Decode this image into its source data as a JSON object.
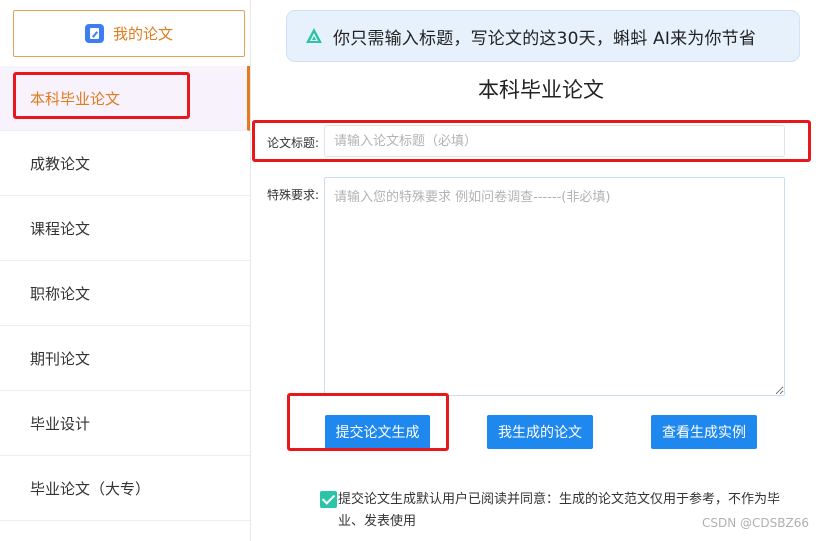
{
  "sidebar": {
    "my_paper_label": "我的论文",
    "items": [
      {
        "label": "本科毕业论文",
        "active": true
      },
      {
        "label": "成教论文",
        "active": false
      },
      {
        "label": "课程论文",
        "active": false
      },
      {
        "label": "职称论文",
        "active": false
      },
      {
        "label": "期刊论文",
        "active": false
      },
      {
        "label": "毕业设计",
        "active": false
      },
      {
        "label": "毕业论文（大专）",
        "active": false
      }
    ]
  },
  "banner": {
    "text": "你只需输入标题，写论文的这30天，蝌蚪 AI来为你节省",
    "icon": "triangle-logo-icon"
  },
  "main": {
    "page_title": "本科毕业论文",
    "title_field": {
      "label": "论文标题:",
      "value": "",
      "placeholder": "请输入论文标题（必填）"
    },
    "requirement_field": {
      "label": "特殊要求:",
      "value": "",
      "placeholder": "请输入您的特殊要求 例如问卷调查------(非必填)"
    },
    "buttons": {
      "submit": "提交论文生成",
      "my_generated": "我生成的论文",
      "view_examples": "查看生成实例"
    },
    "agreement": {
      "checked": true,
      "text": "提交论文生成默认用户已阅读并同意：生成的论文范文仅用于参考，不作为毕业、发表使用"
    }
  },
  "watermark": "CSDN @CDSBZ66",
  "colors": {
    "accent_orange": "#e07b1e",
    "primary_blue": "#1e88ef",
    "highlight_red": "#e8161d",
    "checkbox_green": "#2cc4a7",
    "banner_bg": "#e7f1fc"
  }
}
